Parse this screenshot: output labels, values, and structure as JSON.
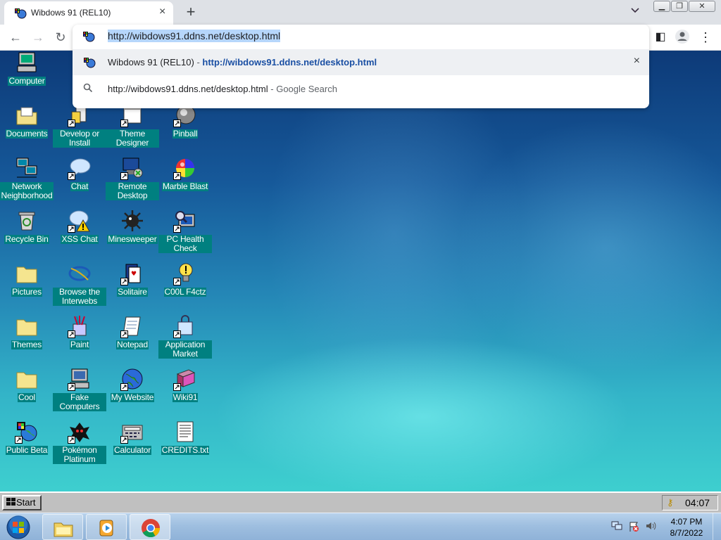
{
  "browser": {
    "tab_title": "Wibdows 91 (REL10)",
    "new_tab": "+",
    "tab_close": "×",
    "tab_search": "⌄",
    "omnibox_value": "http://wibdows91.ddns.net/desktop.html",
    "suggestions": [
      {
        "title": "Wibdows 91 (REL10)",
        "sep": " - ",
        "url": "http://wibdows91.ddns.net/desktop.html",
        "close": "×"
      },
      {
        "title": "http://wibdows91.ddns.net/desktop.html",
        "sep": " - ",
        "suffix": "Google Search"
      }
    ],
    "window_buttons": {
      "minimize": "▁",
      "restore": "❐",
      "close": "✕"
    },
    "nav": {
      "back": "←",
      "forward": "→",
      "reload": "↻",
      "side_panel": "◧",
      "profile": "●",
      "menu": "⋮"
    }
  },
  "desktop": {
    "icons": [
      {
        "label": "Computer",
        "icon": "computer-icon"
      },
      {
        "label": "Documents",
        "icon": "folder-documents-icon"
      },
      {
        "label": "Develop or Install",
        "icon": "develop-install-icon"
      },
      {
        "label": "Theme Designer",
        "icon": "theme-designer-icon"
      },
      {
        "label": "Pinball",
        "icon": "pinball-icon"
      },
      {
        "label": "Network Neighborhood",
        "icon": "network-icon"
      },
      {
        "label": "Chat",
        "icon": "chat-bubble-icon"
      },
      {
        "label": "Remote Desktop",
        "icon": "remote-desktop-icon"
      },
      {
        "label": "Marble Blast",
        "icon": "marble-icon"
      },
      {
        "label": "Recycle Bin",
        "icon": "recycle-bin-icon"
      },
      {
        "label": "XSS Chat",
        "icon": "xss-chat-icon"
      },
      {
        "label": "Minesweeper",
        "icon": "mine-icon"
      },
      {
        "label": "PC Health Check",
        "icon": "pc-health-icon"
      },
      {
        "label": "Pictures",
        "icon": "folder-pictures-icon"
      },
      {
        "label": "Browse the Interwebs",
        "icon": "browser-icon"
      },
      {
        "label": "Solitaire",
        "icon": "cards-icon"
      },
      {
        "label": "C00L F4ctz",
        "icon": "lightbulb-icon"
      },
      {
        "label": "Themes",
        "icon": "folder-themes-icon"
      },
      {
        "label": "Paint",
        "icon": "paint-icon"
      },
      {
        "label": "Notepad",
        "icon": "notepad-icon"
      },
      {
        "label": "Application Market",
        "icon": "shopping-bag-icon"
      },
      {
        "label": "Cool",
        "icon": "folder-cool-icon"
      },
      {
        "label": "Fake Computers",
        "icon": "fake-computer-icon"
      },
      {
        "label": "My Website",
        "icon": "globe-icon"
      },
      {
        "label": "Wiki91",
        "icon": "book-icon"
      },
      {
        "label": "Public Beta",
        "icon": "public-beta-icon"
      },
      {
        "label": "Pokémon Platinum",
        "icon": "pokemon-icon"
      },
      {
        "label": "Calculator",
        "icon": "calculator-icon"
      },
      {
        "label": "CREDITS.txt",
        "icon": "text-file-icon"
      }
    ]
  },
  "w9_taskbar": {
    "start_label": "Start",
    "tray_time": "04:07"
  },
  "w7_taskbar": {
    "clock_time": "4:07 PM",
    "clock_date": "8/7/2022",
    "pinned": [
      "file-explorer-icon",
      "media-player-icon",
      "chrome-icon"
    ]
  }
}
